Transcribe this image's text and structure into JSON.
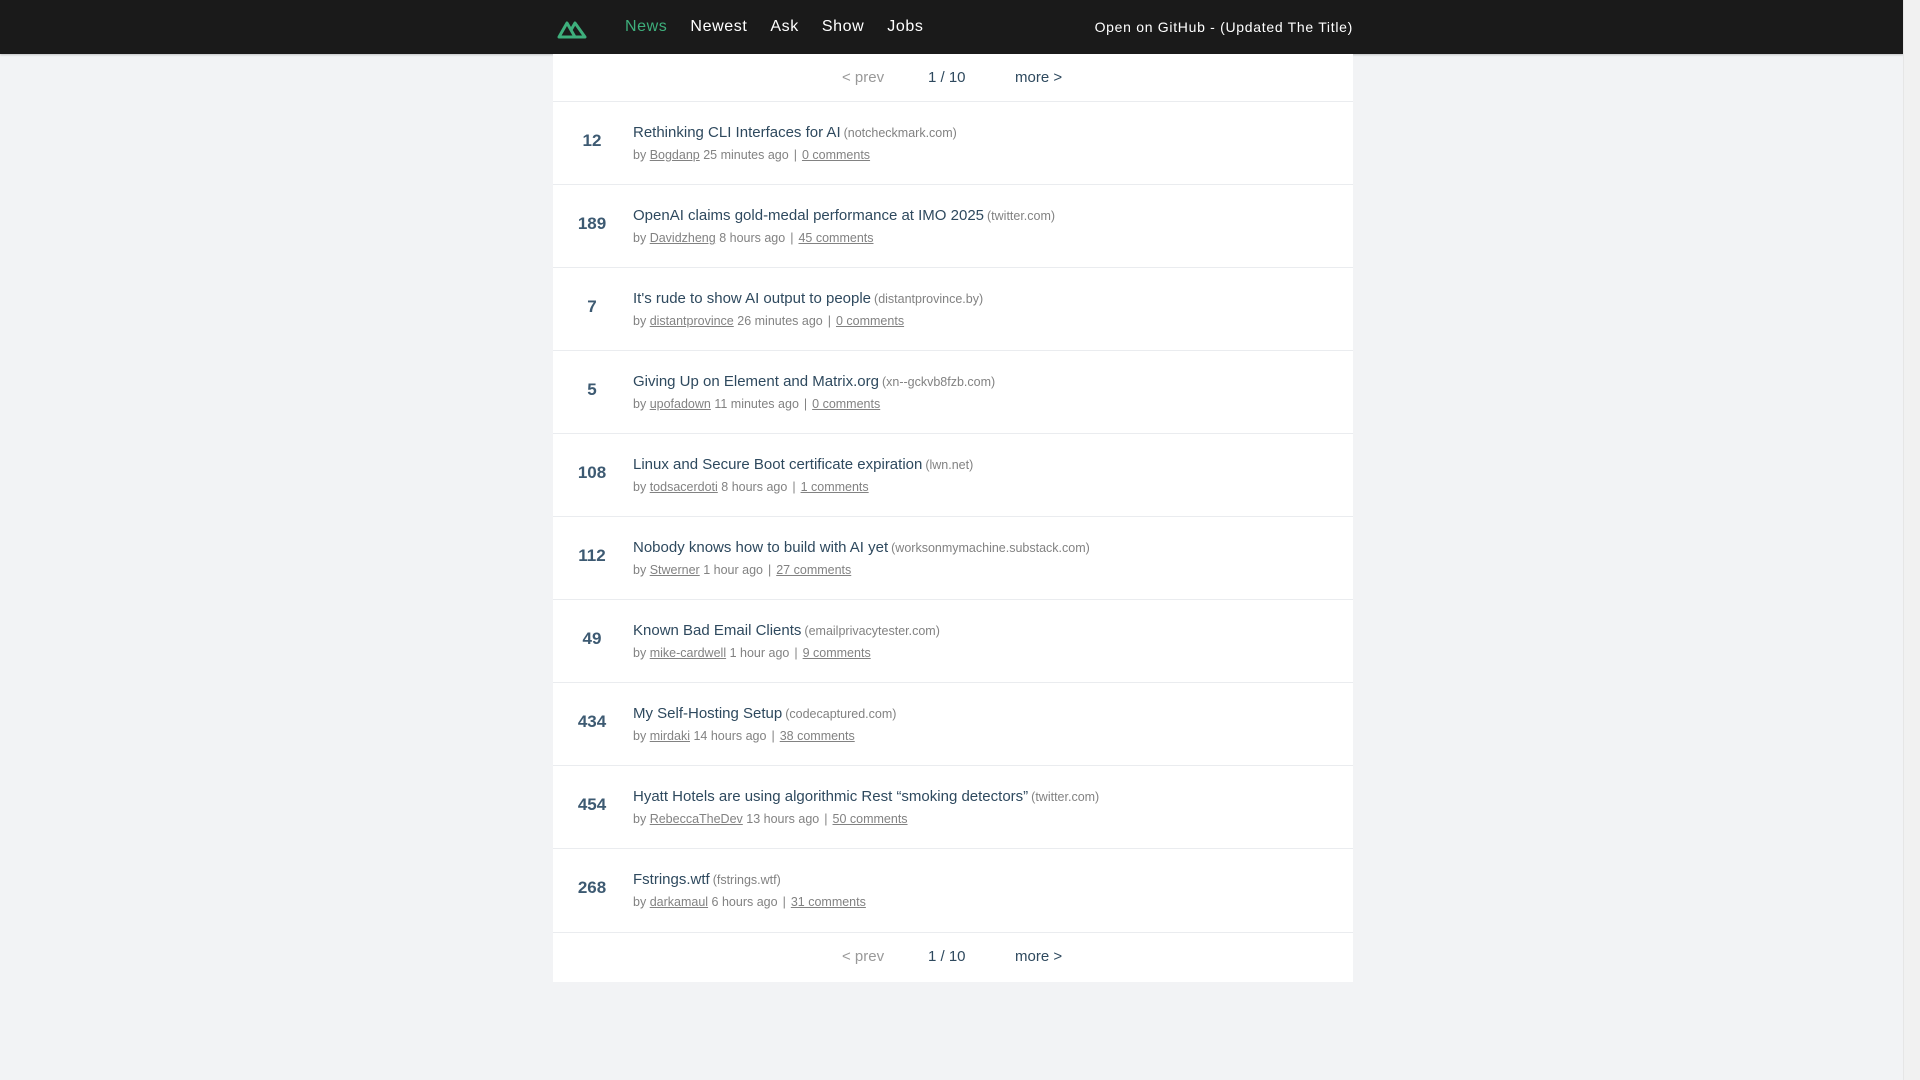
{
  "header": {
    "nav": [
      "News",
      "Newest",
      "Ask",
      "Show",
      "Jobs"
    ],
    "active_index": 0,
    "github_link": "Open on GitHub - (Updated The Title)",
    "accent_color": "#3eaf7c"
  },
  "pager": {
    "prev": "< prev",
    "page": "1 / 10",
    "more": "more >"
  },
  "items": [
    {
      "score": "12",
      "title": "Rethinking CLI Interfaces for AI",
      "host": "(notcheckmark.com)",
      "by": "by",
      "user": "Bogdanp",
      "time": "25 minutes ago",
      "comments": "0 comments"
    },
    {
      "score": "189",
      "title": "OpenAI claims gold-medal performance at IMO 2025",
      "host": "(twitter.com)",
      "by": "by",
      "user": "Davidzheng",
      "time": "8 hours ago",
      "comments": "45 comments"
    },
    {
      "score": "7",
      "title": "It's rude to show AI output to people",
      "host": "(distantprovince.by)",
      "by": "by",
      "user": "distantprovince",
      "time": "26 minutes ago",
      "comments": "0 comments"
    },
    {
      "score": "5",
      "title": "Giving Up on Element and Matrix.org",
      "host": "(xn--gckvb8fzb.com)",
      "by": "by",
      "user": "upofadown",
      "time": "11 minutes ago",
      "comments": "0 comments"
    },
    {
      "score": "108",
      "title": "Linux and Secure Boot certificate expiration",
      "host": "(lwn.net)",
      "by": "by",
      "user": "todsacerdoti",
      "time": "8 hours ago",
      "comments": "1 comments"
    },
    {
      "score": "112",
      "title": "Nobody knows how to build with AI yet",
      "host": "(worksonmymachine.substack.com)",
      "by": "by",
      "user": "Stwerner",
      "time": "1 hour ago",
      "comments": "27 comments"
    },
    {
      "score": "49",
      "title": "Known Bad Email Clients",
      "host": "(emailprivacytester.com)",
      "by": "by",
      "user": "mike-cardwell",
      "time": "1 hour ago",
      "comments": "9 comments"
    },
    {
      "score": "434",
      "title": "My Self-Hosting Setup",
      "host": "(codecaptured.com)",
      "by": "by",
      "user": "mirdaki",
      "time": "14 hours ago",
      "comments": "38 comments"
    },
    {
      "score": "454",
      "title": "Hyatt Hotels are using algorithmic Rest “smoking detectors”",
      "host": "(twitter.com)",
      "by": "by",
      "user": "RebeccaTheDev",
      "time": "13 hours ago",
      "comments": "50 comments"
    },
    {
      "score": "268",
      "title": "Fstrings.wtf",
      "host": "(fstrings.wtf)",
      "by": "by",
      "user": "darkamaul",
      "time": "6 hours ago",
      "comments": "31 comments"
    }
  ]
}
